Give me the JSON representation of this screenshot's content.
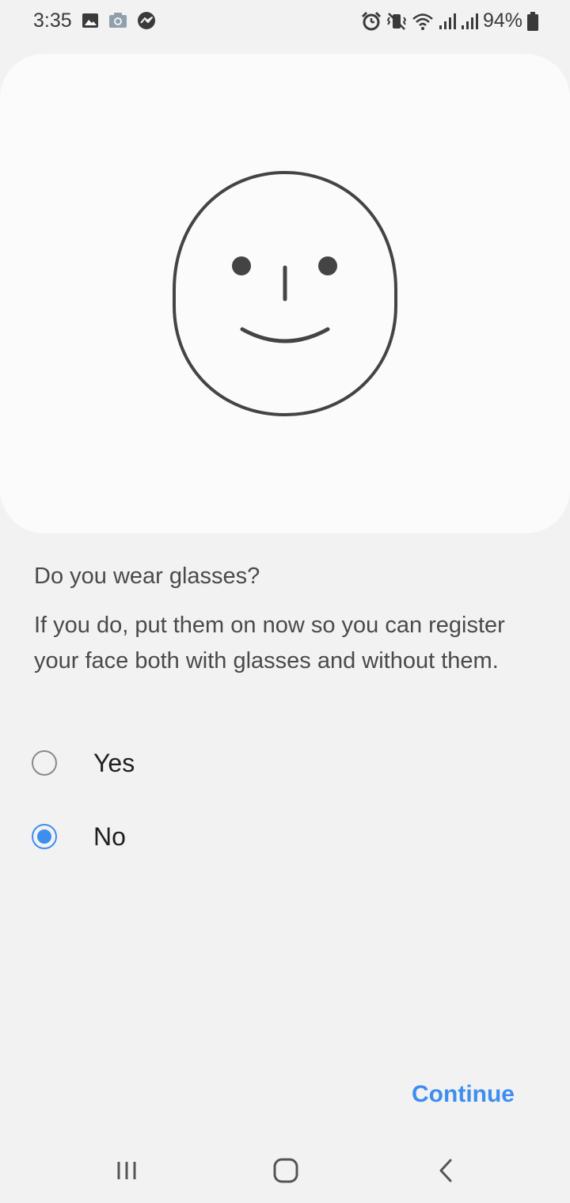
{
  "status_bar": {
    "time": "3:35",
    "left_icons": [
      "image-icon",
      "camera-icon",
      "messenger-icon"
    ],
    "right_icons": [
      "alarm-icon",
      "vibrate-icon",
      "wifi-icon",
      "signal-icon",
      "signal-icon",
      "battery-icon"
    ],
    "battery_percent": "94%"
  },
  "illustration": {
    "icon": "face-icon"
  },
  "content": {
    "question": "Do you wear glasses?",
    "description": "If you do, put them on now so you can register your face both with glasses and without them."
  },
  "options": [
    {
      "label": "Yes",
      "selected": false
    },
    {
      "label": "No",
      "selected": true
    }
  ],
  "actions": {
    "continue_label": "Continue"
  },
  "nav_bar": {
    "buttons": [
      "recent-apps-icon",
      "home-icon",
      "back-icon"
    ]
  },
  "colors": {
    "accent": "#3e8ef0",
    "background": "#f2f2f2",
    "card": "#fbfbfb",
    "text": "#4a4a4a"
  }
}
